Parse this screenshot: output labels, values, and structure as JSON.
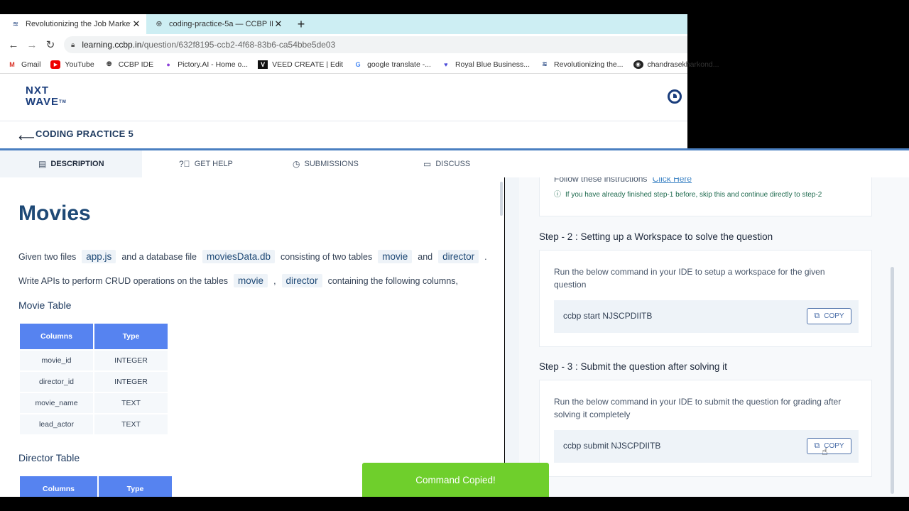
{
  "browser": {
    "tabs": [
      {
        "title": "Revolutionizing the Job Market |",
        "active": true
      },
      {
        "title": "coding-practice-5a — CCBP IDE",
        "active": false
      }
    ],
    "url_host": "learning.ccbp.in",
    "url_path": "/question/632f8195-ccb2-4f68-83b6-ca54bbe5de03",
    "bookmarks": [
      {
        "label": "Gmail",
        "icon": "gmail-icon"
      },
      {
        "label": "YouTube",
        "icon": "youtube-icon"
      },
      {
        "label": "CCBP IDE",
        "icon": "globe-icon"
      },
      {
        "label": "Pictory.AI - Home o...",
        "icon": "pictory-icon"
      },
      {
        "label": "VEED CREATE | Edit",
        "icon": "veed-icon"
      },
      {
        "label": "google translate -...",
        "icon": "google-icon"
      },
      {
        "label": "Royal Blue Business...",
        "icon": "shield-icon"
      },
      {
        "label": "Revolutionizing the...",
        "icon": "nxtwave-icon"
      },
      {
        "label": "chandrasekharkond...",
        "icon": "github-icon"
      }
    ]
  },
  "app": {
    "logo_line1": "NXT",
    "logo_line2": "WAVE",
    "logo_tm": "TM",
    "practice_title": "CODING PRACTICE 5"
  },
  "tabs": [
    {
      "label": "DESCRIPTION"
    },
    {
      "label": "GET HELP"
    },
    {
      "label": "SUBMISSIONS"
    },
    {
      "label": "DISCUSS"
    }
  ],
  "description": {
    "title": "Movies",
    "p1": {
      "t1": "Given two files",
      "c1": "app.js",
      "t2": "and a database file",
      "c2": "moviesData.db",
      "t3": "consisting of two tables",
      "c3": "movie",
      "t4": "and",
      "c4": "director",
      "t5": "."
    },
    "p2": {
      "t1": "Write APIs to perform CRUD operations on the tables",
      "c1": "movie",
      "t2": ",",
      "c2": "director",
      "t3": "containing the following columns,"
    },
    "movie_table": {
      "heading": "Movie Table",
      "headers": [
        "Columns",
        "Type"
      ],
      "rows": [
        [
          "movie_id",
          "INTEGER"
        ],
        [
          "director_id",
          "INTEGER"
        ],
        [
          "movie_name",
          "TEXT"
        ],
        [
          "lead_actor",
          "TEXT"
        ]
      ]
    },
    "director_table": {
      "heading": "Director Table",
      "headers": [
        "Columns",
        "Type"
      ]
    }
  },
  "instructions": {
    "follow_text": "Follow these instructions",
    "follow_link": "Click Here",
    "note": "If you have already finished step-1 before, skip this and continue directly to step-2",
    "step2": {
      "title": "Step - 2 : Setting up a Workspace to solve the question",
      "desc": "Run the below command in your IDE to setup a workspace for the given question",
      "command": "ccbp start NJSCPDIITB",
      "copy_label": "COPY"
    },
    "step3": {
      "title": "Step - 3 : Submit the question after solving it",
      "desc": "Run the below command in your IDE to submit the question for grading after solving it completely",
      "command": "ccbp submit NJSCPDIITB",
      "copy_label": "COPY"
    }
  },
  "toast": {
    "message": "Command Copied!"
  },
  "colors": {
    "accent": "#5683f0",
    "toast": "#6fcf2c",
    "brand": "#1a3d7c"
  }
}
